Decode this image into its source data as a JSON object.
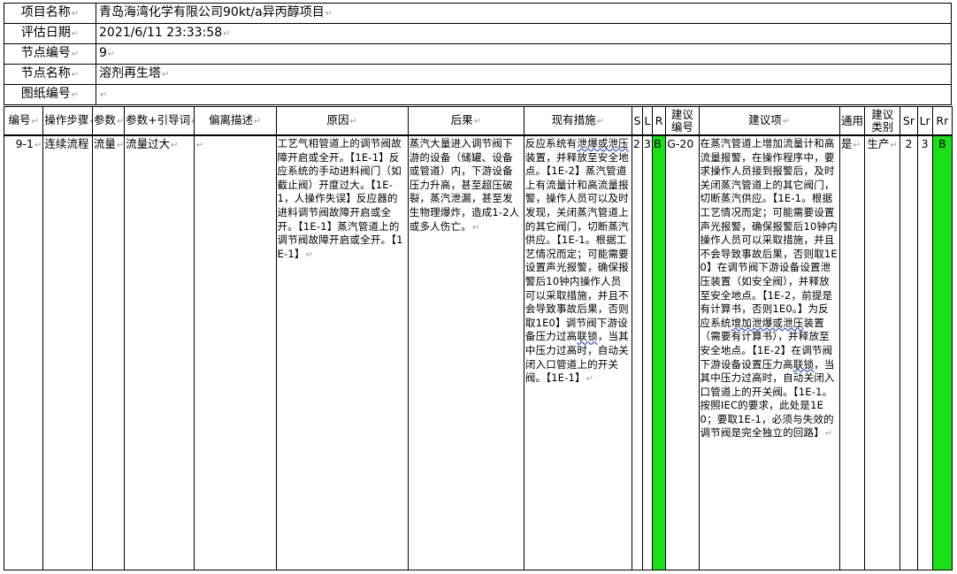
{
  "info": {
    "project_label": "项目名称",
    "project_value": "青岛海湾化学有限公司90kt/a异丙醇项目",
    "date_label": "评估日期",
    "date_value": "2021/6/11 23:33:58",
    "node_no_label": "节点编号",
    "node_no_value": "9",
    "node_name_label": "节点名称",
    "node_name_value": "溶剂再生塔",
    "drawing_label": "图纸编号",
    "drawing_value": "",
    "para_mark": "↵"
  },
  "table": {
    "headers": {
      "no": "编号",
      "step": "操作步骤",
      "param": "参数",
      "guideword": "参数+引导词",
      "deviation": "偏离描述",
      "cause": "原因",
      "consequence": "后果",
      "safeguards": "现有措施",
      "s": "S",
      "l": "L",
      "r": "R",
      "rec_no": "建议编号",
      "recommendation": "建议项",
      "general": "通用",
      "rec_type": "建议类别",
      "sr": "Sr",
      "lr": "Lr",
      "rr": "Rr"
    },
    "row": {
      "no": "9-1",
      "step": "连续流程",
      "param": "流量",
      "guideword": "流量过大",
      "deviation": "",
      "cause": "工艺气相管道上的调节阀故障开启或全开。【1E-1】反应系统的手动进料阀门（如截止阀）开度过大。【1E-1，人操作失误】反应器的进料调节阀故障开启或全开。【1E-1】蒸汽管道上的调节阀故障开启或全开。【1E-1】",
      "consequence": "蒸汽大量进入调节阀下游的设备（储罐、设备或管道）内，下游设备压力升高，甚至超压破裂，蒸汽泄漏，甚至发生物理爆炸，造成1-2人或多人伤亡。",
      "safeguards_pre": "反应系统有",
      "safeguards_u1": "泄爆或泄压",
      "safeguards_post": "装置，并释放至安全地点。【1E-2】蒸汽管道上有流量计和高流量报警，操作人员可以及时发现，关闭蒸汽管道上的其它阀门，切断蒸汽供应。【1E-1。根据工艺情况而定；可能需要设置声光报警，确保报警后10钟内操作人员可以采取措施，并且不会导致事故后果，否则取1E0】调节阀下游设备压力过高",
      "safeguards_u2": "联锁",
      "safeguards_end": "，当其中压力过高时，自动关闭入口管道上的开关阀。【1E-1】",
      "s": "2",
      "l": "3",
      "r": "B",
      "rec_no": "G-20",
      "rec_pre": "在蒸汽管道上增加流量计和高流量报警，在操作程序中，要求操作人员接到报警后，及时关闭蒸汽管道上的其它阀门，切断蒸汽供应。【1E-1。根据工艺情况而定；可能需要设置声光报警，确保报警后10钟内操作人员可以采取措施，并且不会导致事故后果，否则取1E0】在调节阀下游设备设置泄压装置（如安全阀），并释放至安全地点。【1E-2，前提是有计算书，否则1E0。】为反应系统",
      "rec_u1": "增加泄爆或泄压",
      "rec_mid": "装置（需要有计算书），并释放至安全地点。【1E-2】在调节阀下游设备设置压力高",
      "rec_u2": "联锁",
      "rec_end": "，当其中压力过高时，自动关闭入口管道上的开关阀。【1E-1。按照IEC的要求，此处是1E0；要取1E-1，必须与失效的调节阀是完全独立的回路】",
      "general": "是",
      "rec_type": "生产",
      "sr": "2",
      "lr": "3",
      "rr": "B"
    },
    "risk_color": "#19e019"
  }
}
